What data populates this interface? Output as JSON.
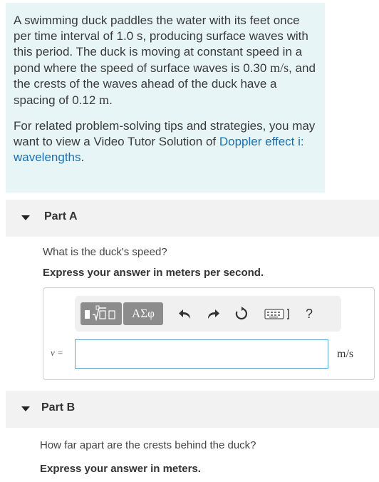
{
  "problem": {
    "p1_a": "A swimming duck paddles the water with its feet once per time interval of 1.0 s, producing surface waves with this period. The duck is moving at constant speed in a pond where the speed of surface waves is 0.30",
    "p1_unit1": "m/s",
    "p1_b": ", and the crests of the waves ahead of the duck have a spacing of 0.12",
    "p1_unit2": "m",
    "p1_c": ".",
    "p2_a": "For related problem-solving tips and strategies, you may want to view a Video Tutor Solution of ",
    "p2_link": "Doppler effect i: wavelengths",
    "p2_b": "."
  },
  "partA": {
    "title": "Part A",
    "question": "What is the duck's speed?",
    "instruction": "Express your answer in meters per second.",
    "variable_label": "v =",
    "unit": "m/s",
    "input_value": "",
    "toolbar": {
      "symbols_label": "ΑΣφ",
      "help_label": "?",
      "icons": [
        "templates-icon",
        "undo-icon",
        "redo-icon",
        "reset-icon",
        "keyboard-icon",
        "help-icon"
      ]
    }
  },
  "partB": {
    "title": "Part B",
    "question": "How far apart are the crests behind the duck?",
    "instruction": "Express your answer in meters."
  }
}
